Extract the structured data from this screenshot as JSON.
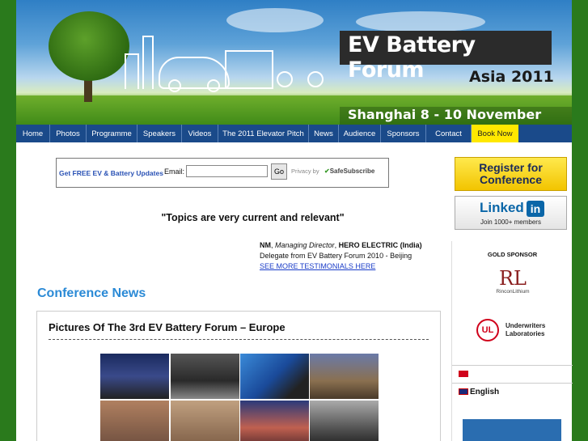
{
  "banner": {
    "title": "EV Battery Forum",
    "subtitle": "Asia 2011",
    "dates": "Shanghai  8 - 10 November"
  },
  "nav": {
    "items": [
      {
        "label": "Home"
      },
      {
        "label": "Photos"
      },
      {
        "label": "Programme"
      },
      {
        "label": "Speakers"
      },
      {
        "label": "Videos"
      },
      {
        "label": "The 2011 Elevator Pitch"
      },
      {
        "label": "News"
      },
      {
        "label": "Audience"
      },
      {
        "label": "Sponsors"
      },
      {
        "label": "Contact"
      },
      {
        "label": "Book Now"
      }
    ]
  },
  "subscribe": {
    "label": "Get FREE EV & Battery Updates",
    "email_label": "Email:",
    "email_value": "",
    "go_label": "Go",
    "privacy": "Privacy by",
    "brand": "SafeSubscribe"
  },
  "quote": {
    "text": "\"Topics are very current and relevant\"",
    "author_name": "NM",
    "author_title": "Managing Director",
    "author_company": "HERO ELECTRIC (India)",
    "event": "Delegate from EV Battery Forum 2010 - Beijing",
    "more_link": "SEE MORE TESTIMONIALS HERE"
  },
  "news": {
    "heading": "Conference News",
    "post_title": "Pictures Of The 3rd EV Battery Forum – Europe"
  },
  "sidebar": {
    "register_label": "Register for Conference",
    "linkedin_word": "Linked",
    "linkedin_badge": "in",
    "linkedin_members": "Join 1000+ members",
    "gold_sponsor": "GOLD SPONSOR",
    "rl_mark": "RL",
    "rl_name": "RinconLithium",
    "ul_mark": "UL",
    "ul_name": "Underwriters Laboratories",
    "lang_english": "English"
  },
  "colors": {
    "nav_bg": "#1a4a8a",
    "book_now": "#ffe800",
    "news_heading": "#2b8ad6",
    "link": "#1a3cc8"
  }
}
